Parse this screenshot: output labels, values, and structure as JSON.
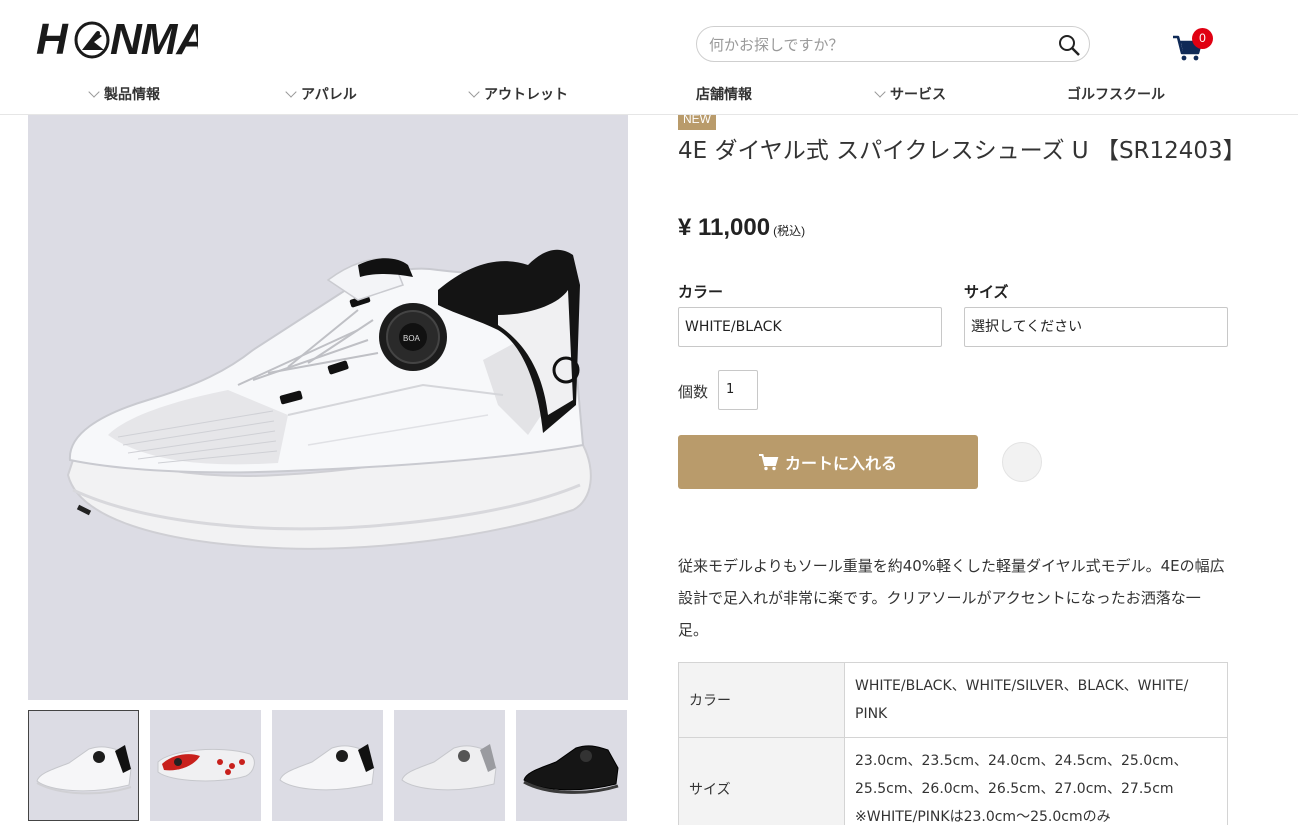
{
  "header": {
    "logo_text": "HONMA",
    "search_placeholder": "何かお探しですか？",
    "cart_count": "0"
  },
  "nav": {
    "items": [
      {
        "label": "製品情報",
        "has_dropdown": true
      },
      {
        "label": "アパレル",
        "has_dropdown": true
      },
      {
        "label": "アウトレット",
        "has_dropdown": true
      },
      {
        "label": "店舗情報",
        "has_dropdown": false
      },
      {
        "label": "サービス",
        "has_dropdown": true
      },
      {
        "label": "ゴルフスクール",
        "has_dropdown": false
      }
    ]
  },
  "gallery": {
    "thumbnail_count": 5,
    "active_index": 0
  },
  "product": {
    "badge": "NEW",
    "title": "4E ダイヤル式 スパイクレスシューズ U 【SR12403】",
    "price": "¥ 11,000",
    "tax_note": "(税込)",
    "color_label": "カラー",
    "color_value": "WHITE/BLACK",
    "size_label": "サイズ",
    "size_value": "選択してください",
    "qty_label": "個数",
    "qty_value": "1",
    "add_to_cart_label": "カートに入れる",
    "description": "従来モデルよりもソール重量を約40%軽くした軽量ダイヤル式モデル。4Eの幅広設計で足入れが非常に楽です。クリアソールがアクセントになったお洒落な一足。"
  },
  "specs": [
    {
      "label": "カラー",
      "lines": [
        "WHITE/BLACK、WHITE/SILVER、BLACK、WHITE/",
        "PINK"
      ]
    },
    {
      "label": "サイズ",
      "lines": [
        "23.0cm、23.5cm、24.0cm、24.5cm、25.0cm、",
        "25.5cm、26.0cm、26.5cm、27.0cm、27.5cm",
        "※WHITE/PINKは23.0cm〜25.0cmのみ"
      ]
    }
  ],
  "colors": {
    "accent": "#b99b6b",
    "badge_red": "#e00012",
    "image_bg": "#dcdce4"
  }
}
